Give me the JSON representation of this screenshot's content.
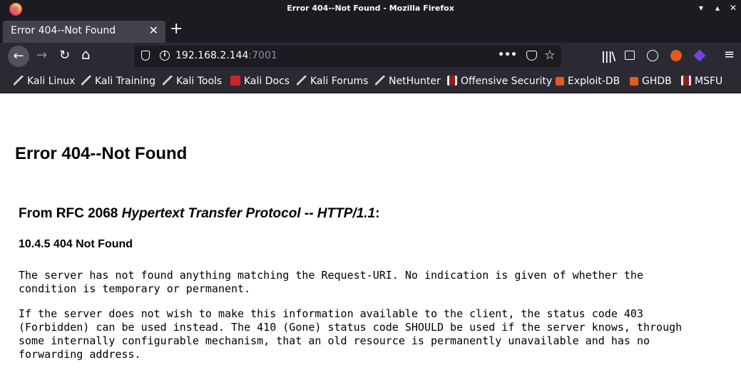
{
  "window": {
    "title": "Error 404--Not Found - Mozilla Firefox"
  },
  "tab": {
    "label": "Error 404--Not Found",
    "close": "✕",
    "new_tab": "+"
  },
  "nav": {
    "back": "←",
    "forward": "→",
    "reload": "↻",
    "home": "⌂",
    "url_host": "192.168.2.144",
    "url_port": ":7001",
    "more": "•••",
    "bookmark_star": "☆"
  },
  "toolbar_icons": [
    "library-icon",
    "sidebar-icon",
    "account-icon",
    "extension-icon",
    "extension-icon-2",
    "menu-icon"
  ],
  "bookmarks": [
    {
      "label": "Kali Linux",
      "icon": "kali-icon"
    },
    {
      "label": "Kali Training",
      "icon": "kali-icon"
    },
    {
      "label": "Kali Tools",
      "icon": "kali-icon"
    },
    {
      "label": "Kali Docs",
      "icon": "red-doc-icon"
    },
    {
      "label": "Kali Forums",
      "icon": "kali-icon"
    },
    {
      "label": "NetHunter",
      "icon": "kali-icon"
    },
    {
      "label": "Offensive Security",
      "icon": "offsec-icon"
    },
    {
      "label": "Exploit-DB",
      "icon": "exploitdb-icon"
    },
    {
      "label": "GHDB",
      "icon": "exploitdb-icon"
    },
    {
      "label": "MSFU",
      "icon": "offsec-icon"
    }
  ],
  "page": {
    "heading": "Error 404--Not Found",
    "rfc_prefix": "From RFC 2068 ",
    "rfc_title": "Hypertext Transfer Protocol -- HTTP/1.1",
    "rfc_suffix": ":",
    "section": "10.4.5 404 Not Found",
    "para1": "The server has not found anything matching the Request-URI. No indication is given of whether the\ncondition is temporary or permanent.",
    "para2": "If the server does not wish to make this information available to the client, the status code 403\n(Forbidden) can be used instead. The 410 (Gone) status code SHOULD be used if the server knows, through\nsome internally configurable mechanism, that an old resource is permanently unavailable and has no\nforwarding address."
  },
  "colors": {
    "chrome_dark": "#1c1b22",
    "toolbar": "#2b2a33",
    "tab_active": "#42414d",
    "text_light": "#fbfbfe",
    "url_port": "#8f8f9d"
  }
}
